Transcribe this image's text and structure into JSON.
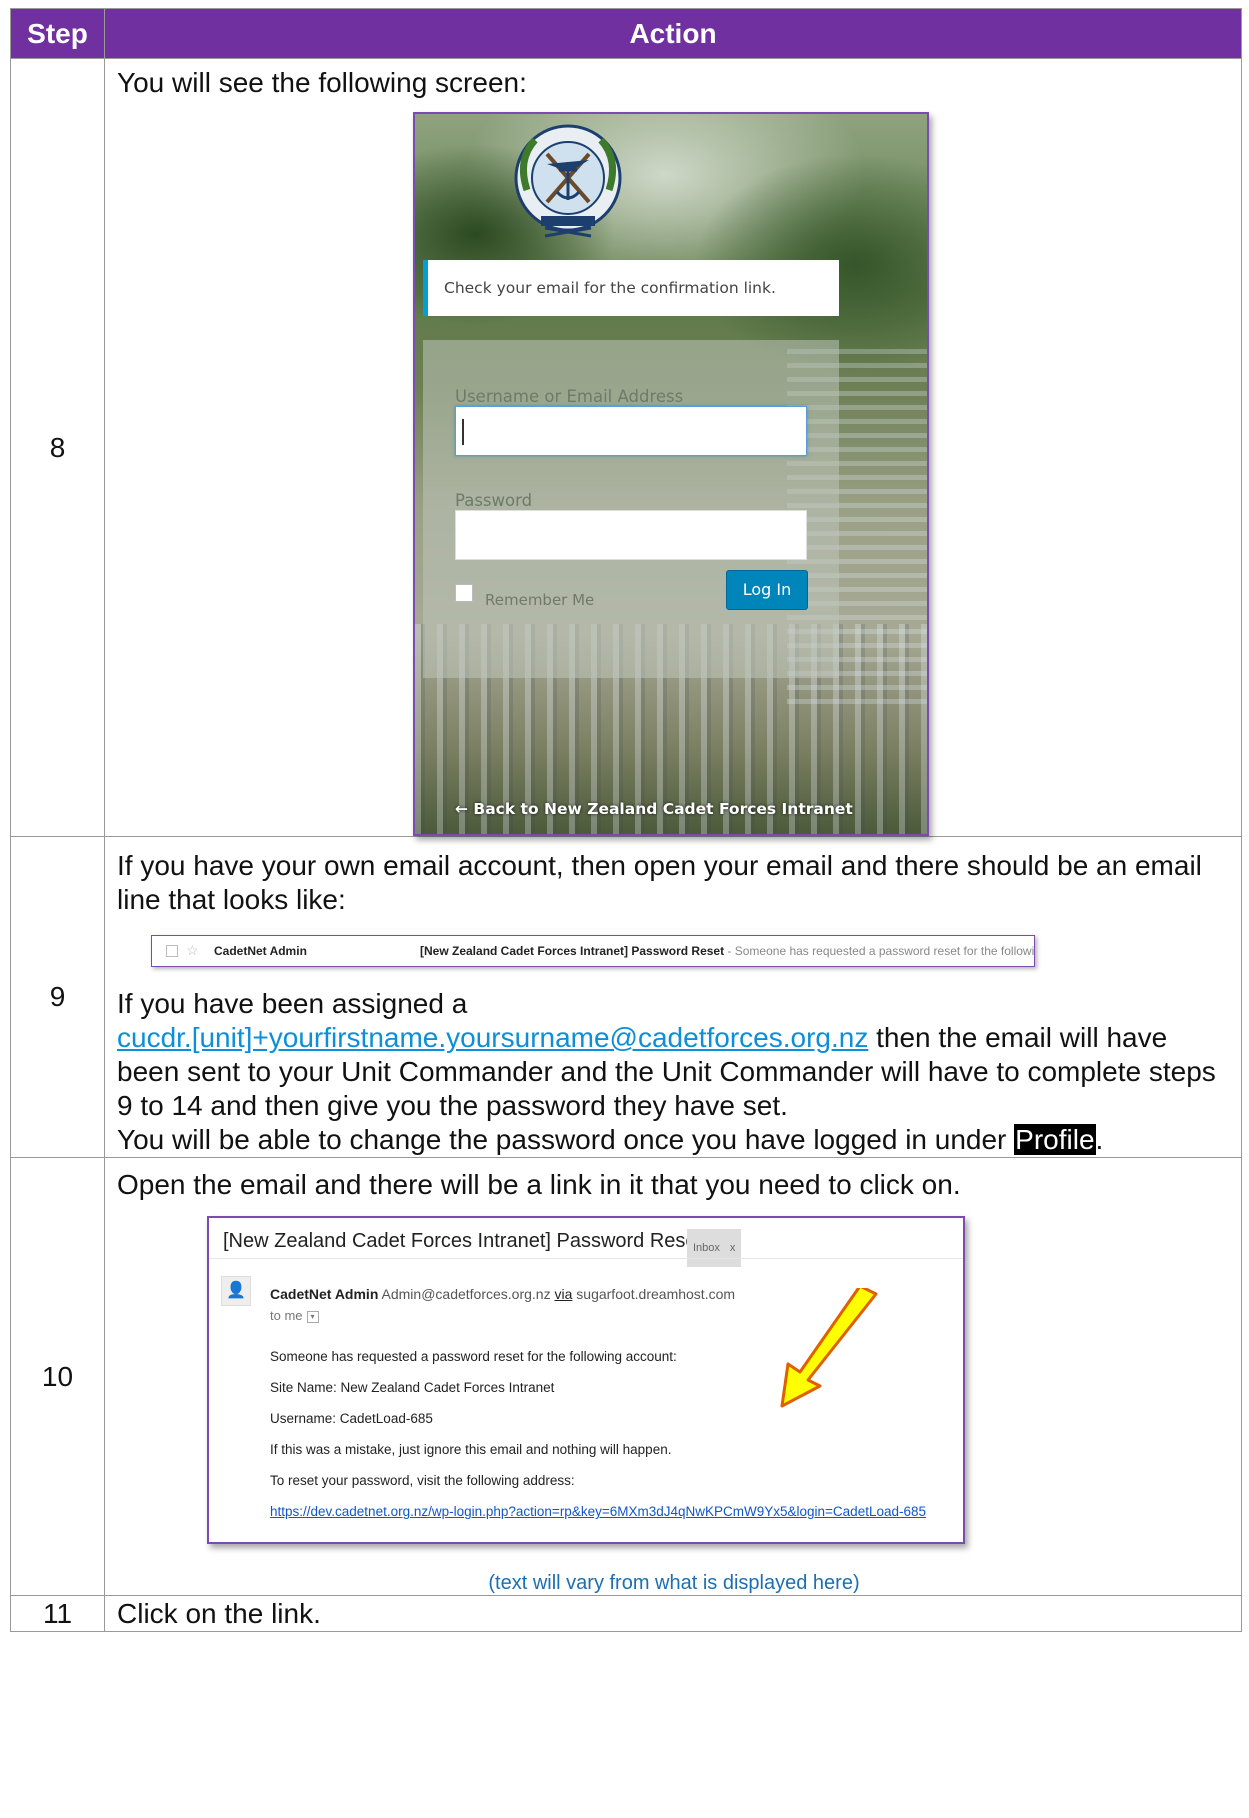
{
  "headers": {
    "step": "Step",
    "action": "Action"
  },
  "step8": {
    "number": "8",
    "intro": "You will see the following screen:",
    "login": {
      "notice": "Check your email for the confirmation link.",
      "username_label": "Username or Email Address",
      "password_label": "Password",
      "remember_label": "Remember Me",
      "login_button": "Log In",
      "back_link": "← Back to New Zealand Cadet Forces Intranet"
    }
  },
  "step9": {
    "number": "9",
    "intro": "If you have your own email account, then open your email and there should be an email line that looks like:",
    "inbox_line": {
      "from": "CadetNet Admin",
      "subject": "[New Zealand Cadet Forces Intranet] Password Reset",
      "snippet": " - Someone has requested a password reset for the following account:"
    },
    "assigned_prefix": "If you have been assigned a",
    "assigned_email": "cucdr.[unit]+yourfirstname.yoursurname@cadetforces.org.nz",
    "assigned_suffix": " then the email will have been sent to your Unit Commander and the Unit Commander will have to complete steps 9 to 14 and then give you the password they have set.",
    "change_prefix": "You will be able to change the password once you have logged in under ",
    "profile": "Profile",
    "change_suffix": "."
  },
  "step10": {
    "number": "10",
    "intro": "Open the email and there will be a link in it that you need to click on.",
    "email": {
      "subject": "[New Zealand Cadet Forces Intranet] Password Reset",
      "inbox_tag": "Inbox",
      "inbox_tag_close": "x",
      "sender_name": "CadetNet Admin",
      "sender_address": "Admin@cadetforces.org.nz",
      "via": "via",
      "via_host": "sugarfoot.dreamhost.com",
      "to": "to me",
      "line1": "Someone has requested a password reset for the following account:",
      "line2": "Site Name: New Zealand Cadet Forces Intranet",
      "line3": "Username: CadetLoad-685",
      "line4": "If this was a mistake, just ignore this email and nothing will happen.",
      "line5": "To reset your password, visit the following address:",
      "url": "https://dev.cadetnet.org.nz/wp-login.php?action=rp&key=6MXm3dJ4qNwKPCmW9Yx5&login=CadetLoad-685"
    },
    "caption": "(text will vary from what is displayed here)"
  },
  "step11": {
    "number": "11",
    "action": "Click on the link."
  },
  "colors": {
    "header_bg": "#7030a0",
    "link": "#0d8fd8",
    "arrow_fill": "#ffff00",
    "arrow_stroke": "#e06000"
  }
}
